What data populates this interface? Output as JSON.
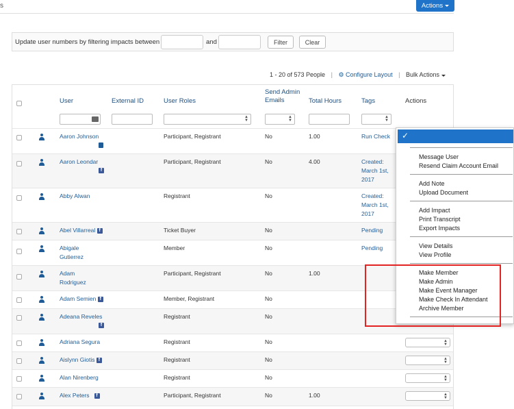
{
  "header": {
    "fragment": "s",
    "actions_label": "Actions"
  },
  "filter": {
    "label": "Update user numbers by filtering impacts between",
    "and_label": "and",
    "from_value": "",
    "to_value": "",
    "filter_label": "Filter",
    "clear_label": "Clear"
  },
  "toolbar": {
    "range": "1 - 20 of 573 People",
    "configure": "Configure Layout",
    "bulk": "Bulk Actions"
  },
  "columns": {
    "user": "User",
    "external_id": "External ID",
    "user_roles": "User Roles",
    "send_admin_1": "Send Admin",
    "send_admin_2": "Emails",
    "total_hours": "Total Hours",
    "tags": "Tags",
    "actions": "Actions"
  },
  "rows": [
    {
      "name1": "Aaron Johnson",
      "name2": "",
      "roles": "Participant, Registrant",
      "send": "No",
      "hours": "1.00",
      "tag1": "Run Check",
      "tag2": "",
      "tag3": ""
    },
    {
      "name1": "Aaron Leondar",
      "name2": "",
      "roles": "Participant, Registrant",
      "send": "No",
      "hours": "4.00",
      "tag1": "Created:",
      "tag2": "March 1st,",
      "tag3": "2017"
    },
    {
      "name1": "Abby Alwan",
      "name2": "",
      "roles": "Registrant",
      "send": "No",
      "hours": "",
      "tag1": "Created:",
      "tag2": "March 1st,",
      "tag3": "2017"
    },
    {
      "name1": "Abel Villarreal",
      "name2": "",
      "roles": "Ticket Buyer",
      "send": "No",
      "hours": "",
      "tag1": "Pending",
      "tag2": "",
      "tag3": ""
    },
    {
      "name1": "Abigale",
      "name2": "Gutierrez",
      "roles": "Member",
      "send": "No",
      "hours": "",
      "tag1": "Pending",
      "tag2": "",
      "tag3": ""
    },
    {
      "name1": "Adam",
      "name2": "Rodriguez",
      "roles": "Participant, Registrant",
      "send": "No",
      "hours": "1.00",
      "tag1": "",
      "tag2": "",
      "tag3": ""
    },
    {
      "name1": "Adam Semien",
      "name2": "",
      "roles": "Member, Registrant",
      "send": "No",
      "hours": "",
      "tag1": "",
      "tag2": "",
      "tag3": ""
    },
    {
      "name1": "Adeana Reveles",
      "name2": "",
      "roles": "Registrant",
      "send": "No",
      "hours": "",
      "tag1": "",
      "tag2": "",
      "tag3": ""
    },
    {
      "name1": "Adriana Segura",
      "name2": "",
      "roles": "Registrant",
      "send": "No",
      "hours": "",
      "tag1": "",
      "tag2": "",
      "tag3": ""
    },
    {
      "name1": "Aislynn Giotis",
      "name2": "",
      "roles": "Registrant",
      "send": "No",
      "hours": "",
      "tag1": "",
      "tag2": "",
      "tag3": ""
    },
    {
      "name1": "Alan Nirenberg",
      "name2": "",
      "roles": "Registrant",
      "send": "No",
      "hours": "",
      "tag1": "",
      "tag2": "",
      "tag3": ""
    },
    {
      "name1": "Alex Peters",
      "name2": "",
      "roles": "Participant, Registrant",
      "send": "No",
      "hours": "1.00",
      "tag1": "",
      "tag2": "",
      "tag3": ""
    }
  ],
  "dropdown": {
    "selected_glyph": "✓",
    "items": [
      "Message User",
      "Resend Claim Account Email",
      "Add Note",
      "Upload Document",
      "Add Impact",
      "Print Transcript",
      "Export Impacts",
      "View Details",
      "View Profile",
      "Make Member",
      "Make Admin",
      "Make Event Manager",
      "Make Check In Attendant",
      "Archive Member"
    ]
  },
  "icons": {
    "person": "person-icon",
    "facebook": "facebook-icon",
    "document": "document-icon",
    "gear": "gear-icon",
    "calendar": "calendar-icon"
  },
  "colors": {
    "primary": "#1f73c9",
    "link": "#1f5b96",
    "highlight": "#e32222",
    "facebook": "#3b5998"
  }
}
